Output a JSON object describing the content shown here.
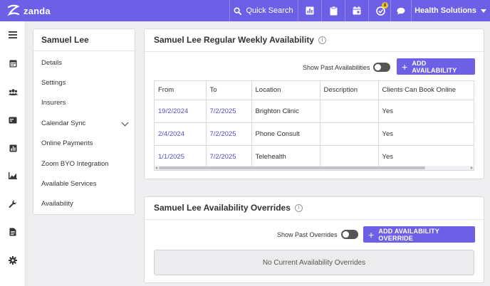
{
  "brand": {
    "name": "zanda",
    "accent": "#6d5fe6"
  },
  "topbar": {
    "search_label": "Quick Search",
    "notification_count": "8",
    "org_name": "Health Solutions",
    "icons": [
      "search-icon",
      "report-icon",
      "clipboard-icon",
      "calendar-icon",
      "task-check-icon",
      "chat-icon",
      "caret-down-icon"
    ]
  },
  "leftnav": {
    "icons": [
      "menu-icon",
      "calendar-icon",
      "users-icon",
      "billing-icon",
      "reports-icon",
      "chart-icon",
      "wrench-icon",
      "document-icon",
      "settings-icon"
    ]
  },
  "sidemenu": {
    "title": "Samuel Lee",
    "items": [
      {
        "label": "Details"
      },
      {
        "label": "Settings"
      },
      {
        "label": "Insurers"
      },
      {
        "label": "Calendar Sync"
      },
      {
        "label": "Online Payments"
      },
      {
        "label": "Zoom BYO Integration"
      },
      {
        "label": "Available Services"
      },
      {
        "label": "Availability"
      }
    ]
  },
  "weekly": {
    "title": "Samuel Lee Regular Weekly Availability",
    "toggle_label": "Show Past Availabilities",
    "add_button": "ADD AVAILABILITY",
    "columns": [
      "From",
      "To",
      "Location",
      "Description",
      "Clients Can Book Online"
    ],
    "rows": [
      {
        "from": "19/2/2024",
        "to": "7/2/2025",
        "location": "Brighton Clinic",
        "description": "",
        "book_online": "Yes"
      },
      {
        "from": "2/4/2024",
        "to": "7/2/2025",
        "location": "Phone Consult",
        "description": "",
        "book_online": "Yes"
      },
      {
        "from": "1/1/2025",
        "to": "7/2/2025",
        "location": "Telehealth",
        "description": "",
        "book_online": "Yes"
      }
    ]
  },
  "overrides": {
    "title": "Samuel Lee Availability Overrides",
    "toggle_label": "Show Past Overrides",
    "add_button": "ADD AVAILABILITY OVERRIDE",
    "empty_text": "No Current Availability Overrides"
  }
}
